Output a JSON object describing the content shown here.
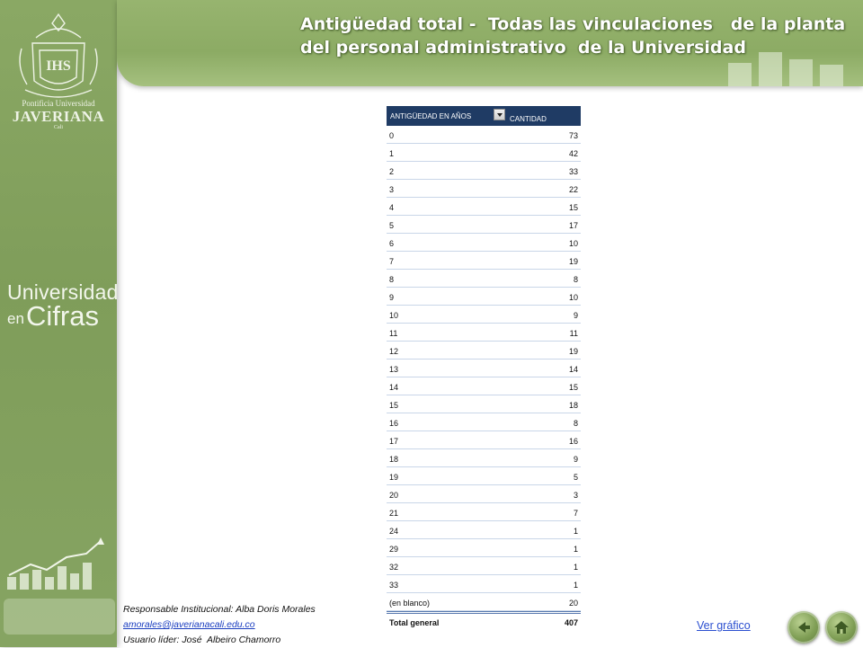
{
  "sidebar": {
    "logo": {
      "monogram": "IHS",
      "line1": "Pontificia Universidad",
      "line2": "JAVERIANA",
      "line3": "Cali"
    },
    "brand_line1": "Universidad",
    "brand_en": "en",
    "brand_cifras": "Cifras"
  },
  "header": {
    "title_line1": "Antigüedad total -  Todas las vinculaciones   de la planta",
    "title_line2": "del personal administrativo  de la Universidad"
  },
  "table": {
    "col_key": "ANTIGÜEDAD EN AÑOS",
    "col_value": "CANTIDAD",
    "rows": [
      {
        "k": "0",
        "v": "73"
      },
      {
        "k": "1",
        "v": "42"
      },
      {
        "k": "2",
        "v": "33"
      },
      {
        "k": "3",
        "v": "22"
      },
      {
        "k": "4",
        "v": "15"
      },
      {
        "k": "5",
        "v": "17"
      },
      {
        "k": "6",
        "v": "10"
      },
      {
        "k": "7",
        "v": "19"
      },
      {
        "k": "8",
        "v": "8"
      },
      {
        "k": "9",
        "v": "10"
      },
      {
        "k": "10",
        "v": "9"
      },
      {
        "k": "11",
        "v": "11"
      },
      {
        "k": "12",
        "v": "19"
      },
      {
        "k": "13",
        "v": "14"
      },
      {
        "k": "14",
        "v": "15"
      },
      {
        "k": "15",
        "v": "18"
      },
      {
        "k": "16",
        "v": "8"
      },
      {
        "k": "17",
        "v": "16"
      },
      {
        "k": "18",
        "v": "9"
      },
      {
        "k": "19",
        "v": "5"
      },
      {
        "k": "20",
        "v": "3"
      },
      {
        "k": "21",
        "v": "7"
      },
      {
        "k": "24",
        "v": "1"
      },
      {
        "k": "29",
        "v": "1"
      },
      {
        "k": "32",
        "v": "1"
      },
      {
        "k": "33",
        "v": "1"
      },
      {
        "k": "(en blanco)",
        "v": "20"
      }
    ],
    "total_label": "Total general",
    "total_value": "407"
  },
  "footer": {
    "responsable": "Responsable Institucional: Alba Doris Morales",
    "email": "amorales@javerianacali.edu.co",
    "usuario": "Usuario líder: José  Albeiro Chamorro"
  },
  "nav": {
    "ver_grafico": "Ver gráfico",
    "back_icon": "arrow-left-icon",
    "home_icon": "home-icon"
  },
  "colors": {
    "sidebar_green": "#86a462",
    "table_header": "#1f3b64",
    "link_blue": "#2b4fd0"
  }
}
